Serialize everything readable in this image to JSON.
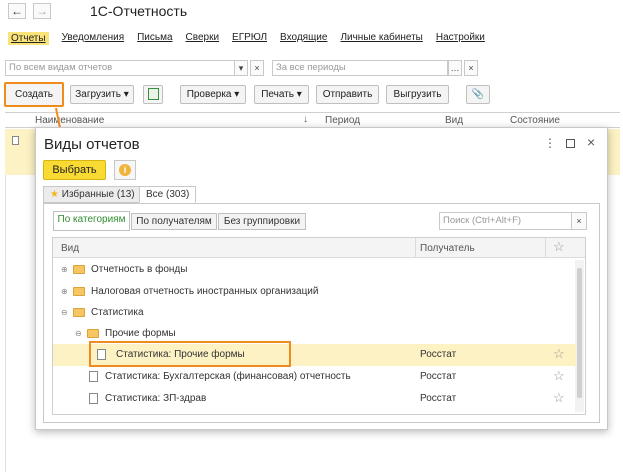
{
  "app": {
    "title": "1С-Отчетность",
    "back_icon": "←",
    "forward_icon": "→"
  },
  "menu": [
    {
      "label": "Отчеты",
      "active": true
    },
    {
      "label": "Уведомления"
    },
    {
      "label": "Письма"
    },
    {
      "label": "Сверки"
    },
    {
      "label": "ЕГРЮЛ"
    },
    {
      "label": "Входящие"
    },
    {
      "label": "Личные кабинеты"
    },
    {
      "label": "Настройки"
    }
  ],
  "filters": {
    "report_types_placeholder": "По всем видам отчетов",
    "periods_placeholder": "За все периоды"
  },
  "toolbar": {
    "create": "Создать",
    "load": "Загрузить",
    "check": "Проверка",
    "print": "Печать",
    "send": "Отправить",
    "upload": "Выгрузить"
  },
  "table": {
    "columns": [
      "Наименование",
      "Период",
      "Вид",
      "Состояние"
    ]
  },
  "dialog": {
    "title": "Виды отчетов",
    "choose": "Выбрать",
    "tabs": {
      "favorites": "Избранные (13)",
      "all": "Все (303)"
    },
    "grouping": {
      "by_category": "По категориям",
      "by_recipient": "По получателям",
      "none": "Без группировки"
    },
    "search_placeholder": "Поиск (Ctrl+Alt+F)",
    "grid": {
      "col_kind": "Вид",
      "col_recipient": "Получатель",
      "rows": [
        {
          "label": "Отчетность в фонды",
          "recipient": ""
        },
        {
          "label": "Налоговая отчетность иностранных организаций",
          "recipient": ""
        },
        {
          "label": "Статистика",
          "recipient": ""
        },
        {
          "label": "Прочие формы",
          "recipient": ""
        },
        {
          "label": "Статистика: Прочие формы",
          "recipient": "Росстат"
        },
        {
          "label": "Статистика: Бухгалтерская (финансовая) отчетность",
          "recipient": "Росстат"
        },
        {
          "label": "Статистика: ЗП-здрав",
          "recipient": "Росстат"
        }
      ]
    }
  },
  "colors": {
    "accent": "#f08c1e",
    "highlight": "#fdf2c4",
    "button_yellow": "#f8da33"
  }
}
